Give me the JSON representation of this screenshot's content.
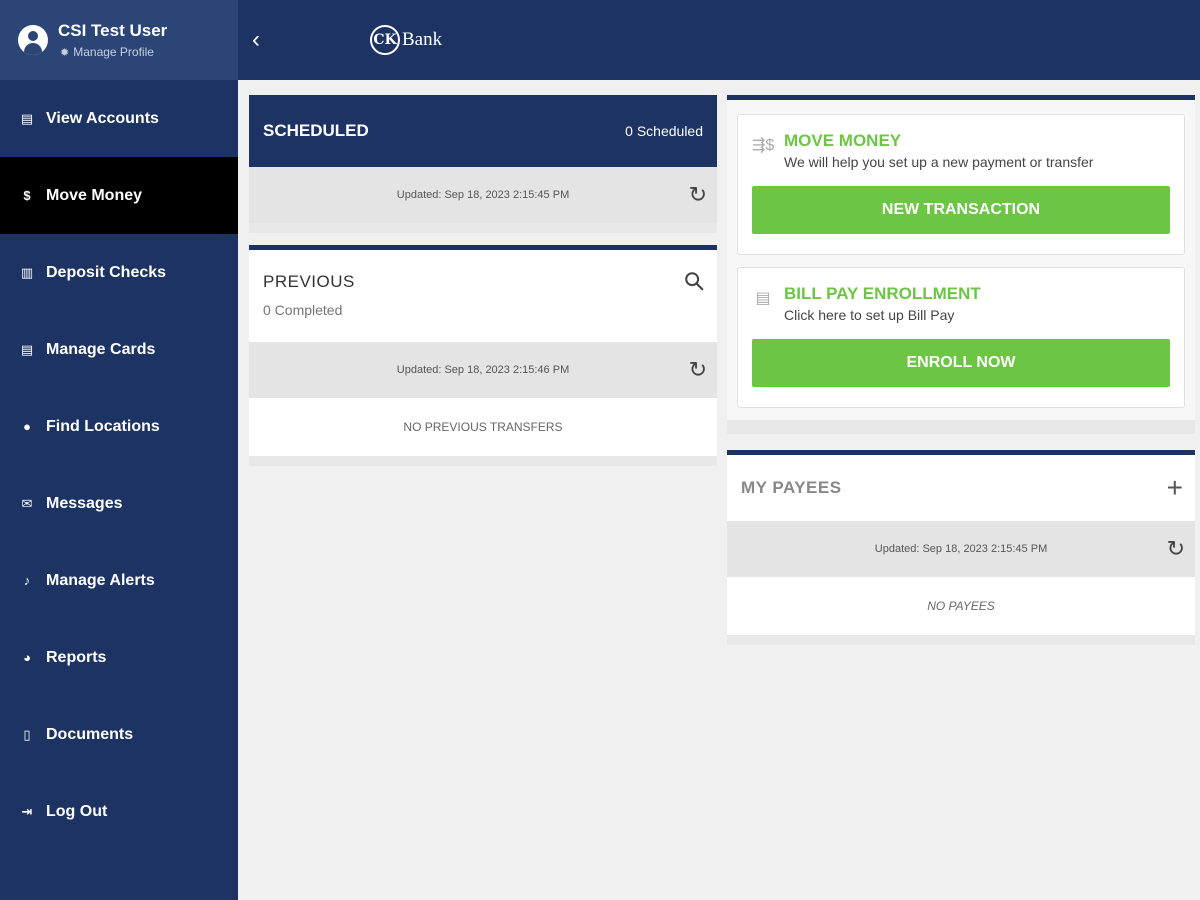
{
  "sidebar": {
    "profile": {
      "name": "CSI Test User",
      "manage_label": "Manage Profile"
    },
    "items": [
      {
        "label": "View Accounts",
        "icon": "accounts-icon"
      },
      {
        "label": "Move Money",
        "icon": "dollar-icon",
        "active": true
      },
      {
        "label": "Deposit Checks",
        "icon": "bank-icon"
      },
      {
        "label": "Manage Cards",
        "icon": "card-icon"
      },
      {
        "label": "Find Locations",
        "icon": "pin-icon"
      },
      {
        "label": "Messages",
        "icon": "mail-icon"
      },
      {
        "label": "Manage Alerts",
        "icon": "bell-icon"
      },
      {
        "label": "Reports",
        "icon": "pie-chart-icon"
      },
      {
        "label": "Documents",
        "icon": "document-icon"
      },
      {
        "label": "Log Out",
        "icon": "logout-icon"
      }
    ]
  },
  "header": {
    "logo_letters": "CK",
    "logo_text": "Bank"
  },
  "scheduled": {
    "title": "SCHEDULED",
    "count": "0 Scheduled",
    "updated": "Updated: Sep 18, 2023 2:15:45 PM"
  },
  "previous": {
    "title": "PREVIOUS",
    "subtitle": "0 Completed",
    "updated": "Updated: Sep 18, 2023 2:15:46 PM",
    "empty": "NO PREVIOUS TRANSFERS"
  },
  "move_money": {
    "title": "MOVE MONEY",
    "description": "We will help you set up a new payment or transfer",
    "button": "NEW TRANSACTION"
  },
  "bill_pay": {
    "title": "BILL PAY ENROLLMENT",
    "description": "Click here to set up Bill Pay",
    "button": "ENROLL NOW"
  },
  "payees": {
    "title": "MY PAYEES",
    "updated": "Updated: Sep 18, 2023 2:15:45 PM",
    "empty": "NO PAYEES"
  },
  "colors": {
    "navy": "#1c3363",
    "profile_bg": "#2b4576",
    "active_bg": "#000000",
    "accent_green": "#6cc644",
    "page_bg": "#f0f0f0"
  }
}
